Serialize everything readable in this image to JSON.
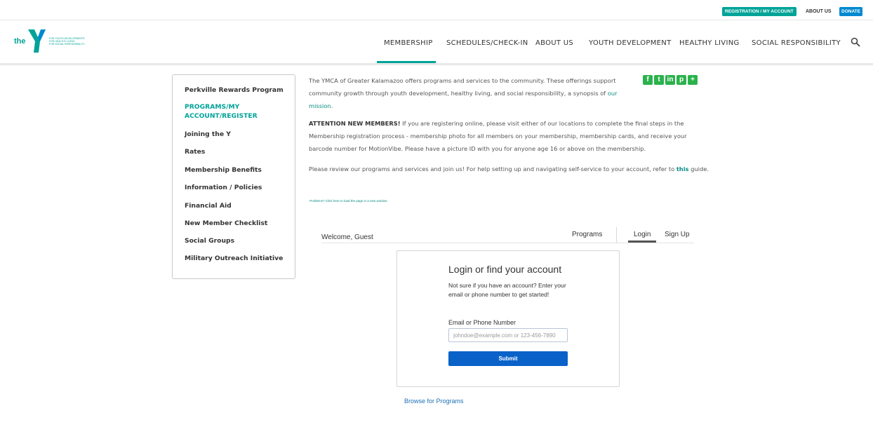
{
  "utility_bar": {
    "registration_label": "REGISTRATION / MY ACCOUNT",
    "about_label": "ABOUT US",
    "donate_label": "DONATE"
  },
  "logo": {
    "the": "the",
    "tagline": [
      "FOR YOUTH DEVELOPMENT®",
      "FOR HEALTHY LIVING",
      "FOR SOCIAL RESPONSIBILITY"
    ]
  },
  "nav": {
    "items": [
      "MEMBERSHIP",
      "SCHEDULES/CHECK-IN",
      "ABOUT US",
      "YOUTH DEVELOPMENT",
      "HEALTHY LIVING",
      "SOCIAL RESPONSIBILITY"
    ],
    "active": "MEMBERSHIP"
  },
  "sidebar": {
    "items": [
      "Perkville Rewards Program",
      "PROGRAMS/MY ACCOUNT/REGISTER",
      "Joining the Y",
      "Rates",
      "Membership Benefits",
      "Information / Policies",
      "Financial Aid",
      "New Member Checklist",
      "Social Groups",
      "Military Outreach Initiative"
    ],
    "active": "PROGRAMS/MY ACCOUNT/REGISTER"
  },
  "content": {
    "intro": "The YMCA of Greater Kalamazoo offers programs and services to the community. These offerings support community growth through youth development, healthy living, and social responsibility, a synopsis of ",
    "intro_link": "our mission",
    "intro_end": ".",
    "attention_label": "ATTENTION NEW MEMBERS!",
    "attention_text": " If you are registering online, please visit either of our locations to complete the final steps in the Membership registration process - membership photo for all members on your membership, membership cards, and receive your barcode number for MotionVibe.  Please have a picture ID with you for anyone age 16 or above on the membership.",
    "review_text": "Please review our programs and services and join us! For help setting up and navigating self-service to your account, refer to ",
    "review_link": "this",
    "review_end": " guide.",
    "problems_link": "Problems? Click here to load the page in a new window"
  },
  "share": {
    "icons": [
      "facebook-icon",
      "twitter-icon",
      "linkedin-icon",
      "pinterest-icon",
      "plus-icon"
    ],
    "glyphs": [
      "f",
      "t",
      "in",
      "p",
      "+"
    ]
  },
  "widget": {
    "welcome": "Welcome, Guest",
    "programs_tab": "Programs",
    "login_tab": "Login",
    "signup_tab": "Sign Up",
    "card_title": "Login or find your account",
    "card_desc": "Not sure if you have an account? Enter your email or phone number to get started!",
    "field_label": "Email or Phone Number",
    "field_placeholder": "johndoe@example.com or 123-456-7890",
    "submit_label": "Submit",
    "browse_link": "Browse for Programs"
  },
  "colors": {
    "teal": "#00a398",
    "donate_blue": "#0089d0",
    "submit_blue": "#0a62c9",
    "share_green": "#2bb24c"
  }
}
